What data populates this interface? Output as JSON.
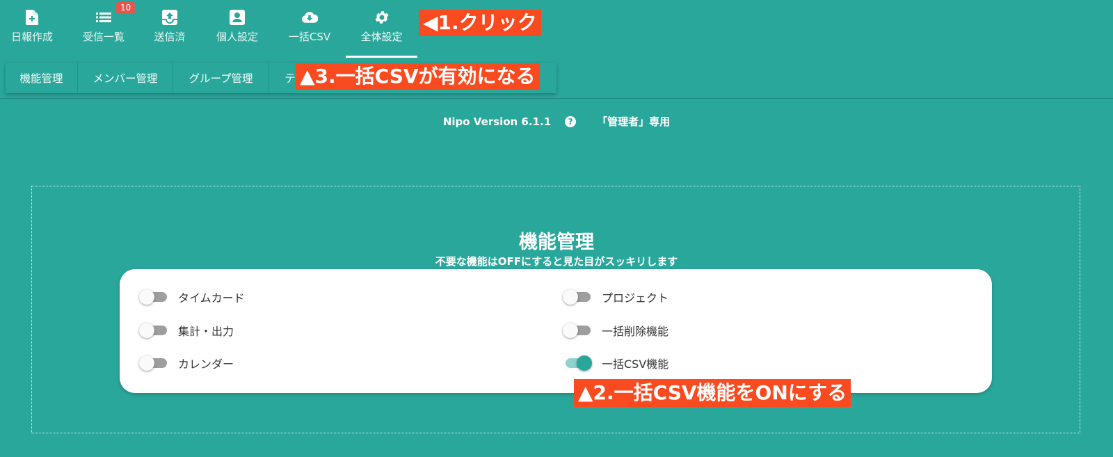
{
  "nav": {
    "items": [
      {
        "label": "日報作成",
        "icon": "add-document-icon"
      },
      {
        "label": "受信一覧",
        "icon": "list-icon",
        "badge": "10"
      },
      {
        "label": "送信済",
        "icon": "outbox-icon"
      },
      {
        "label": "個人設定",
        "icon": "person-card-icon"
      },
      {
        "label": "一括CSV",
        "icon": "cloud-download-icon"
      },
      {
        "label": "全体設定",
        "icon": "gear-icon",
        "active": true
      }
    ]
  },
  "subtabs": [
    {
      "label": "機能管理"
    },
    {
      "label": "メンバー管理"
    },
    {
      "label": "グループ管理"
    },
    {
      "label": "テ"
    }
  ],
  "callouts": {
    "step1": "◀1.クリック",
    "step2": "▲2.一括CSV機能をONにする",
    "step3": "▲3.一括CSVが有効になる"
  },
  "version": {
    "text": "Nipo Version 6.1.1",
    "help": "?",
    "role": "「管理者」専用"
  },
  "section": {
    "title": "機能管理",
    "subtitle": "不要な機能はOFFにすると見た目がスッキリします"
  },
  "features": {
    "left": [
      {
        "label": "タイムカード",
        "on": false
      },
      {
        "label": "集計・出力",
        "on": false
      },
      {
        "label": "カレンダー",
        "on": false
      }
    ],
    "right": [
      {
        "label": "プロジェクト",
        "on": false
      },
      {
        "label": "一括削除機能",
        "on": false
      },
      {
        "label": "一括CSV機能",
        "on": true
      }
    ]
  },
  "colors": {
    "background": "#2aa79b",
    "callout": "#fa4a20",
    "badge": "#e5554e",
    "toggle_on": "#2aa79b",
    "toggle_off": "#9e9e9e"
  }
}
